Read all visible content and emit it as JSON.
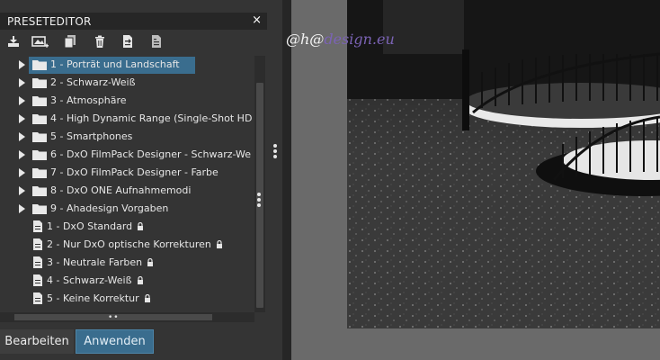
{
  "panel": {
    "title": "PRESETEDITOR",
    "close": "×"
  },
  "toolbar": {
    "icons": [
      "import-icon",
      "new-preset-icon",
      "duplicate-icon",
      "delete-icon",
      "export-icon",
      "rename-icon"
    ]
  },
  "tree": {
    "folders": [
      {
        "label": "1 - Porträt und Landschaft",
        "selected": true
      },
      {
        "label": "2 - Schwarz-Weiß"
      },
      {
        "label": "3 - Atmosphäre"
      },
      {
        "label": "4 - High Dynamic Range (Single-Shot HD"
      },
      {
        "label": "5 - Smartphones"
      },
      {
        "label": "6 - DxO FilmPack Designer - Schwarz-We"
      },
      {
        "label": "7 - DxO FilmPack Designer - Farbe"
      },
      {
        "label": "8 - DxO ONE Aufnahmemodi"
      },
      {
        "label": "9 - Ahadesign Vorgaben"
      }
    ],
    "presets": [
      {
        "label": "1 - DxO Standard",
        "locked": true
      },
      {
        "label": "2 - Nur DxO optische Korrekturen",
        "locked": true
      },
      {
        "label": "3 - Neutrale Farben",
        "locked": true
      },
      {
        "label": "4 - Schwarz-Weiß",
        "locked": true
      },
      {
        "label": "5 - Keine Korrektur",
        "locked": true
      }
    ]
  },
  "buttons": {
    "edit": "Bearbeiten",
    "apply": "Anwenden"
  },
  "viewer": {
    "watermark_part1": "@h@",
    "watermark_part2": "design.eu"
  },
  "colors": {
    "selection": "#3a6d8e",
    "watermark_accent": "#7b63b5"
  }
}
